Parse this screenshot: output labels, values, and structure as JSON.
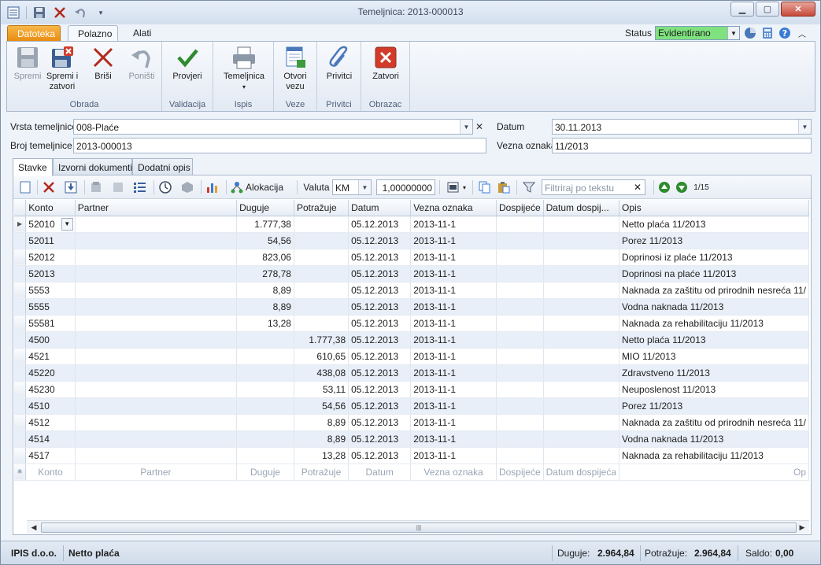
{
  "window": {
    "title": "Temeljnica: 2013-000013"
  },
  "ribbon_tabs": {
    "file": "Datoteka",
    "home": "Polazno",
    "tools": "Alati"
  },
  "status": {
    "label": "Status",
    "value": "Evidentirano"
  },
  "ribbon": {
    "obrada": {
      "title": "Obrada",
      "spremi": "Spremi",
      "spremi_zatvori_1": "Spremi i",
      "spremi_zatvori_2": "zatvori",
      "brisi": "Briši",
      "ponisti": "Poništi"
    },
    "validacija": {
      "title": "Validacija",
      "provjeri": "Provjeri"
    },
    "ispis": {
      "title": "Ispis",
      "temeljnica": "Temeljnica"
    },
    "veze": {
      "title": "Veze",
      "otvori_1": "Otvori",
      "otvori_2": "vezu"
    },
    "privitci": {
      "title": "Privitci",
      "privitci": "Privitci"
    },
    "obrazac": {
      "title": "Obrazac",
      "zatvori": "Zatvori"
    }
  },
  "form": {
    "vrsta_label": "Vrsta temeljnice",
    "vrsta_value": "008-Plaće",
    "broj_label": "Broj temeljnice",
    "broj_value": "2013-000013",
    "datum_label": "Datum",
    "datum_value": "30.11.2013",
    "vezna_label": "Vezna oznaka",
    "vezna_value": "11/2013"
  },
  "content_tabs": {
    "stavke": "Stavke",
    "izvorni": "Izvorni dokumenti",
    "dodatni": "Dodatni opis"
  },
  "toolbar": {
    "alokacija": "Alokacija",
    "valuta_label": "Valuta",
    "valuta_value": "KM",
    "tecaj": "1,00000000",
    "filter_placeholder": "Filtriraj po tekstu",
    "page": "1/15"
  },
  "grid": {
    "headers": [
      "Konto",
      "Partner",
      "Duguje",
      "Potražuje",
      "Datum",
      "Vezna oznaka",
      "Dospijeće",
      "Datum dospij...",
      "Opis"
    ],
    "rows": [
      [
        "52010",
        "",
        "1.777,38",
        "",
        "05.12.2013",
        "2013-11-1",
        "",
        "",
        "Netto plaća 11/2013"
      ],
      [
        "52011",
        "",
        "54,56",
        "",
        "05.12.2013",
        "2013-11-1",
        "",
        "",
        "Porez 11/2013"
      ],
      [
        "52012",
        "",
        "823,06",
        "",
        "05.12.2013",
        "2013-11-1",
        "",
        "",
        "Doprinosi iz plaće 11/2013"
      ],
      [
        "52013",
        "",
        "278,78",
        "",
        "05.12.2013",
        "2013-11-1",
        "",
        "",
        "Doprinosi na plaće 11/2013"
      ],
      [
        "5553",
        "",
        "8,89",
        "",
        "05.12.2013",
        "2013-11-1",
        "",
        "",
        "Naknada za zaštitu od prirodnih nesreća 11/"
      ],
      [
        "5555",
        "",
        "8,89",
        "",
        "05.12.2013",
        "2013-11-1",
        "",
        "",
        "Vodna naknada 11/2013"
      ],
      [
        "55581",
        "",
        "13,28",
        "",
        "05.12.2013",
        "2013-11-1",
        "",
        "",
        "Naknada za rehabilitaciju 11/2013"
      ],
      [
        "4500",
        "",
        "",
        "1.777,38",
        "05.12.2013",
        "2013-11-1",
        "",
        "",
        "Netto plaća 11/2013"
      ],
      [
        "4521",
        "",
        "",
        "610,65",
        "05.12.2013",
        "2013-11-1",
        "",
        "",
        "MIO 11/2013"
      ],
      [
        "45220",
        "",
        "",
        "438,08",
        "05.12.2013",
        "2013-11-1",
        "",
        "",
        "Zdravstveno 11/2013"
      ],
      [
        "45230",
        "",
        "",
        "53,11",
        "05.12.2013",
        "2013-11-1",
        "",
        "",
        "Neuposlenost 11/2013"
      ],
      [
        "4510",
        "",
        "",
        "54,56",
        "05.12.2013",
        "2013-11-1",
        "",
        "",
        "Porez 11/2013"
      ],
      [
        "4512",
        "",
        "",
        "8,89",
        "05.12.2013",
        "2013-11-1",
        "",
        "",
        "Naknada za zaštitu od prirodnih nesreća 11/"
      ],
      [
        "4514",
        "",
        "",
        "8,89",
        "05.12.2013",
        "2013-11-1",
        "",
        "",
        "Vodna naknada 11/2013"
      ],
      [
        "4517",
        "",
        "",
        "13,28",
        "05.12.2013",
        "2013-11-1",
        "",
        "",
        "Naknada za rehabilitaciju 11/2013"
      ]
    ],
    "new_row": [
      "Konto",
      "Partner",
      "Duguje",
      "Potražuje",
      "Datum",
      "Vezna oznaka",
      "Dospijeće",
      "Datum dospijeća",
      "Op"
    ]
  },
  "statusbar": {
    "company": "IPIS d.o.o.",
    "current": "Netto plaća",
    "duguje_label": "Duguje:",
    "duguje_value": "2.964,84",
    "potrazuje_label": "Potražuje:",
    "potrazuje_value": "2.964,84",
    "saldo_label": "Saldo:",
    "saldo_value": "0,00"
  }
}
